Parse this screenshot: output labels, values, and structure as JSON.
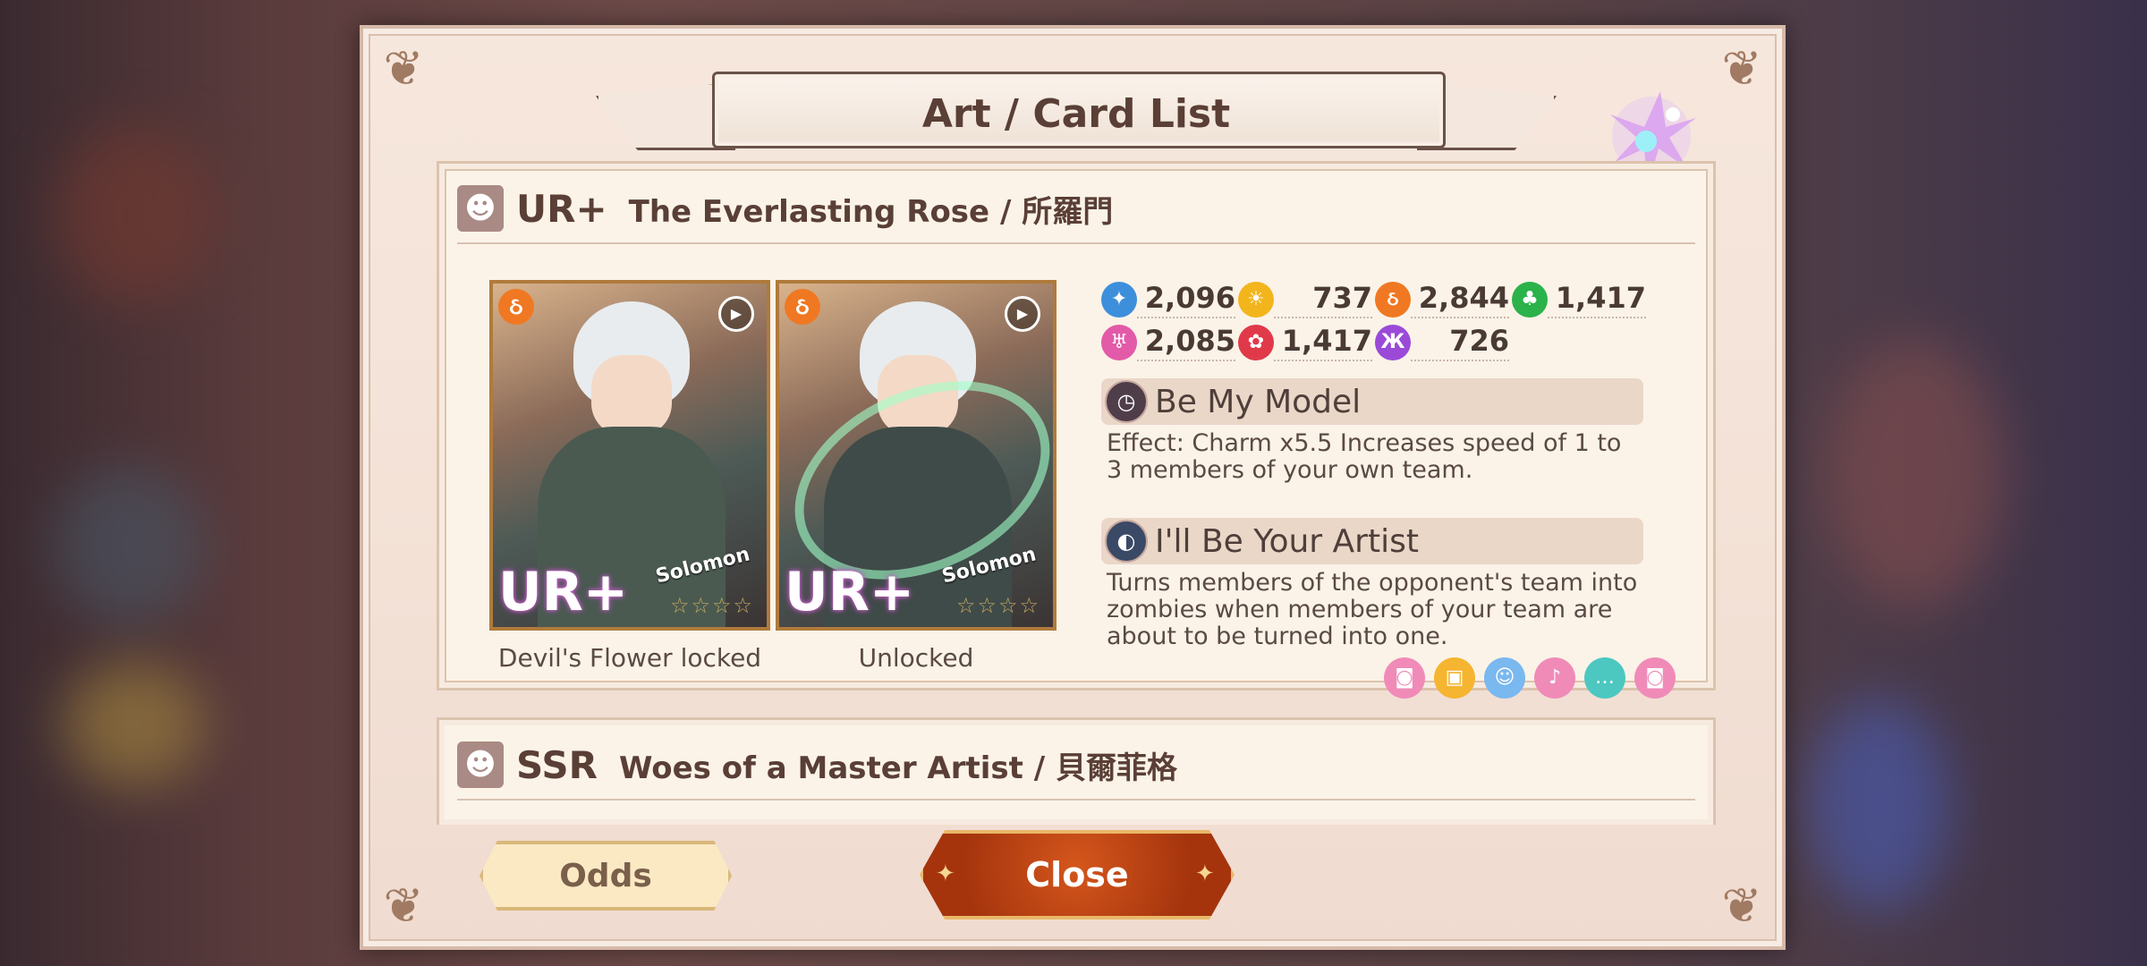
{
  "dialog": {
    "title": "Art / Card List",
    "close_label": "Close",
    "odds_label": "Odds"
  },
  "cards": [
    {
      "rarity": "UR+",
      "name": "The Everlasting Rose / 所羅門",
      "character": "Solomon",
      "art_badge": "UR+",
      "art_captions": [
        "Devil's Flower locked",
        "Unlocked"
      ],
      "stats": [
        {
          "icon": "pride-icon",
          "value": "2,096",
          "color": "#3d8fdc"
        },
        {
          "icon": "sun-icon",
          "value": "737",
          "color": "#f3b51c"
        },
        {
          "icon": "flame-icon",
          "value": "2,844",
          "color": "#f07822"
        },
        {
          "icon": "leaf-icon",
          "value": "1,417",
          "color": "#2bb24a"
        },
        {
          "icon": "charm-icon",
          "value": "2,085",
          "color": "#e35aa8"
        },
        {
          "icon": "rose-icon",
          "value": "1,417",
          "color": "#e03a4a"
        },
        {
          "icon": "wings-icon",
          "value": "726",
          "color": "#9b4ad8"
        }
      ],
      "skills": [
        {
          "title": "Be My Model",
          "description": "Effect: Charm x5.5 Increases speed of 1 to 3 members of your own team."
        },
        {
          "title": "I'll Be Your Artist",
          "description": "Turns members of the opponent's team into zombies when members of your team are about to be turned into one."
        }
      ],
      "bonus_icons": [
        {
          "name": "camera-icon",
          "color": "#f08bb8",
          "glyph": "◙"
        },
        {
          "name": "gift-icon",
          "color": "#f5b530",
          "glyph": "▣"
        },
        {
          "name": "face-icon",
          "color": "#7ab8f0",
          "glyph": "☺"
        },
        {
          "name": "mic-icon",
          "color": "#f08bb8",
          "glyph": "♪"
        },
        {
          "name": "chat-icon",
          "color": "#4cc8c0",
          "glyph": "…"
        },
        {
          "name": "camera-icon",
          "color": "#f08bb8",
          "glyph": "◙"
        }
      ]
    },
    {
      "rarity": "SSR",
      "name": "Woes of a Master Artist / 貝爾菲格"
    }
  ]
}
